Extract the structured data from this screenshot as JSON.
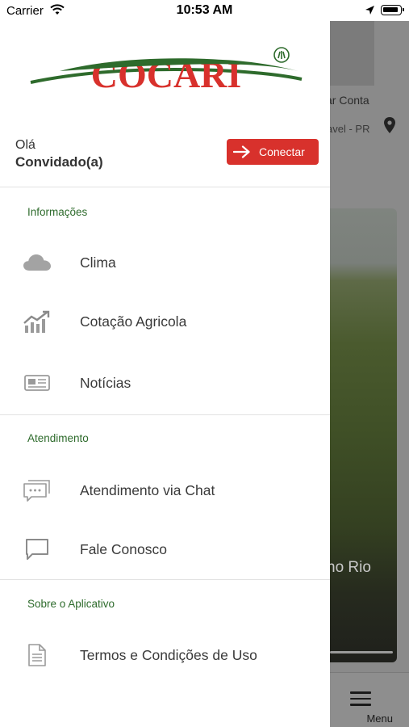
{
  "status_bar": {
    "carrier": "Carrier",
    "time": "10:53 AM"
  },
  "brand": {
    "logo_text": "COCARI",
    "primary_color": "#d8312c",
    "accent_green": "#2e6b2c"
  },
  "greeting": {
    "hello": "Olá",
    "name": "Convidado(a)"
  },
  "connect_button": {
    "label": "Conectar",
    "icon": "arrow-right-icon"
  },
  "sections": [
    {
      "title": "Informações",
      "items": [
        {
          "label": "Clima",
          "icon": "cloud-icon"
        },
        {
          "label": "Cotação Agricola",
          "icon": "chart-up-icon"
        },
        {
          "label": "Notícias",
          "icon": "newspaper-icon"
        }
      ]
    },
    {
      "title": "Atendimento",
      "items": [
        {
          "label": "Atendimento via Chat",
          "icon": "chat-bubbles-icon"
        },
        {
          "label": "Fale Conosco",
          "icon": "message-icon"
        }
      ]
    },
    {
      "title": "Sobre o Aplicativo",
      "items": [
        {
          "label": "Termos e Condições de Uso",
          "icon": "document-icon"
        }
      ]
    }
  ],
  "background_app": {
    "account_text": "sar Conta",
    "city_text": "avel - PR",
    "photo_caption": "no Rio",
    "menu_label": "Menu"
  }
}
